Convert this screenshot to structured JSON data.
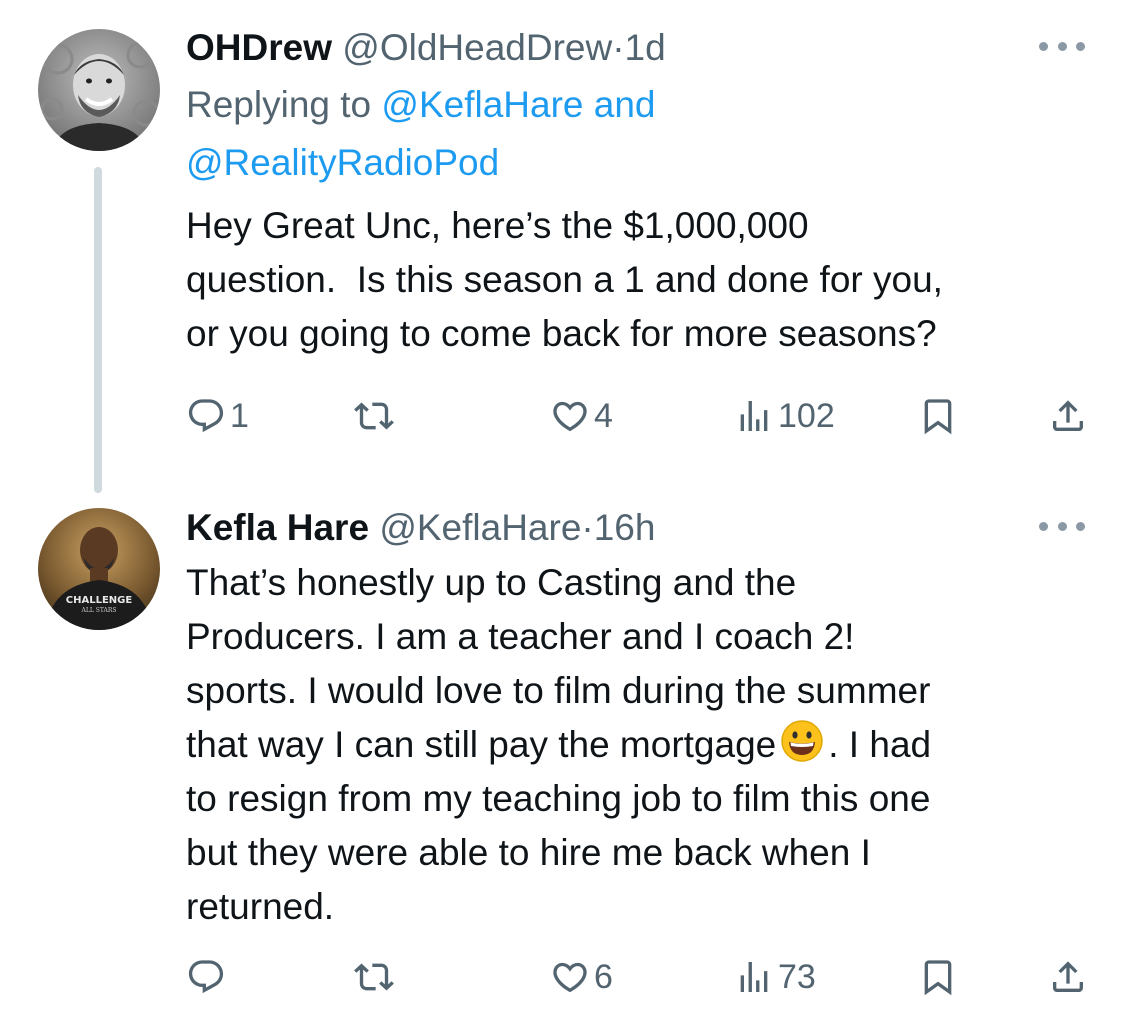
{
  "tweets": [
    {
      "display_name": "OHDrew",
      "handle": "@OldHeadDrew",
      "separator": "·",
      "time": "1d",
      "replying_prefix": "Replying to ",
      "replying_mention_1": "@KeflaHare",
      "replying_and": " and",
      "replying_mention_2": "@RealityRadioPod",
      "text": "Hey Great Unc, here’s the $1,000,000\nquestion.  Is this season a 1 and done for you,\nor you going to come back for more seasons?",
      "replies": "1",
      "retweets": "",
      "likes": "4",
      "views": "102"
    },
    {
      "display_name": "Kefla Hare",
      "handle": "@KeflaHare",
      "separator": "·",
      "time": "16h",
      "text_before_emoji": "That’s honestly up to Casting and the\nProducers. I am a teacher and I coach 2!\nsports. I would love to film during the summer\nthat way I can still pay the mortgage",
      "text_after_emoji": ". I had\nto resign from my teaching job to film this one\nbut they were able to hire me back when I\nreturned.",
      "avatar_shirt_text_1": "CHALLENGE",
      "avatar_shirt_text_2": "ALL STARS",
      "replies": "",
      "retweets": "",
      "likes": "6",
      "views": "73"
    }
  ],
  "icons": {
    "reply": "reply-icon",
    "retweet": "retweet-icon",
    "like": "heart-icon",
    "views": "views-icon",
    "bookmark": "bookmark-icon",
    "share": "share-icon",
    "more": "more-icon",
    "emoji": "grinning-face-emoji"
  },
  "colors": {
    "text": "#0f1419",
    "secondary": "#536471",
    "link": "#1d9bf0",
    "thread_line": "#cfd9de"
  }
}
